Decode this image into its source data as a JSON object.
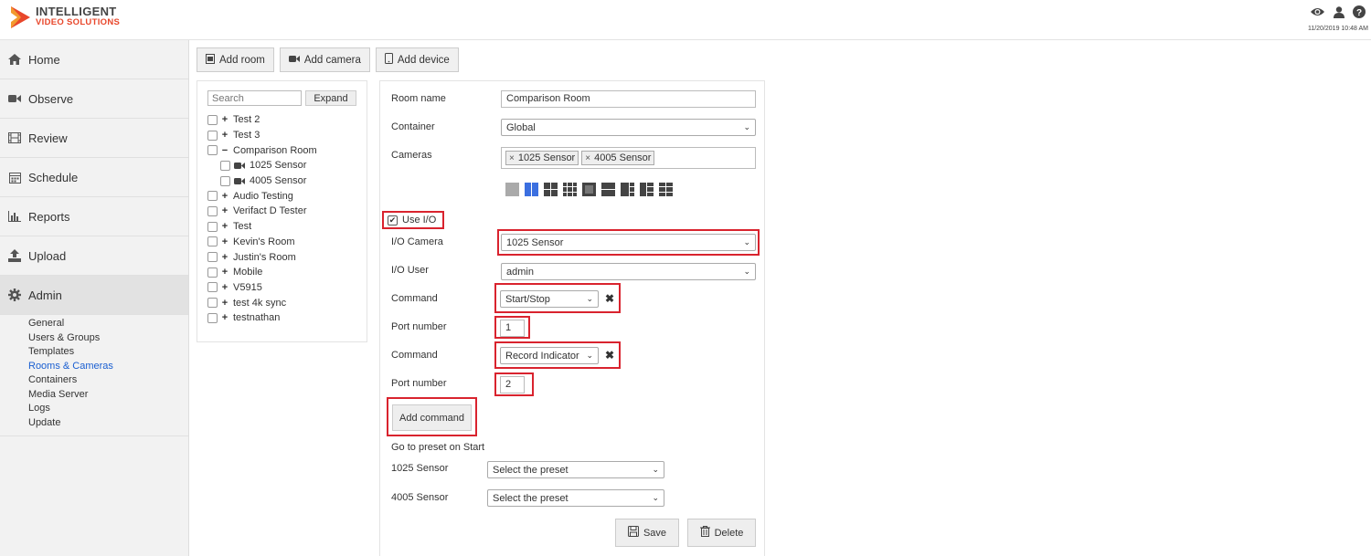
{
  "app": {
    "logo_line1": "INTELLIGENT",
    "logo_line2": "VIDEO SOLUTIONS",
    "datetime": "11/20/2019 10:48 AM",
    "brand_accent": "#e8472b",
    "header_icons": [
      "eye-icon",
      "user-icon",
      "help-icon"
    ]
  },
  "sidebar": {
    "items": [
      {
        "label": "Home",
        "icon": "home-icon"
      },
      {
        "label": "Observe",
        "icon": "video-camera-icon"
      },
      {
        "label": "Review",
        "icon": "film-icon"
      },
      {
        "label": "Schedule",
        "icon": "calendar-icon"
      },
      {
        "label": "Reports",
        "icon": "bar-chart-icon"
      },
      {
        "label": "Upload",
        "icon": "upload-icon"
      },
      {
        "label": "Admin",
        "icon": "gear-icon"
      }
    ],
    "admin_sub": [
      "General",
      "Users & Groups",
      "Templates",
      "Rooms & Cameras",
      "Containers",
      "Media Server",
      "Logs",
      "Update"
    ],
    "link_color": "#1a5fd1"
  },
  "toolbar": {
    "add_room": "Add room",
    "add_camera": "Add camera",
    "add_device": "Add device"
  },
  "tree": {
    "search_placeholder": "Search",
    "expand_label": "Expand",
    "rooms": [
      {
        "label": "Test 2",
        "toggle": "+"
      },
      {
        "label": "Test 3",
        "toggle": "+"
      },
      {
        "label": "Comparison Room",
        "toggle": "−"
      },
      {
        "label": "1025 Sensor",
        "child": true
      },
      {
        "label": "4005 Sensor",
        "child": true
      },
      {
        "label": "Audio Testing",
        "toggle": "+"
      },
      {
        "label": "Verifact D Tester",
        "toggle": "+"
      },
      {
        "label": "Test",
        "toggle": "+"
      },
      {
        "label": "Kevin's Room",
        "toggle": "+"
      },
      {
        "label": "Justin's Room",
        "toggle": "+"
      },
      {
        "label": "Mobile",
        "toggle": "+"
      },
      {
        "label": "V5915",
        "toggle": "+"
      },
      {
        "label": "test 4k sync",
        "toggle": "+"
      },
      {
        "label": "testnathan",
        "toggle": "+"
      }
    ]
  },
  "form": {
    "room_name_label": "Room name",
    "room_name_value": "Comparison Room",
    "container_label": "Container",
    "container_value": "Global",
    "cameras_label": "Cameras",
    "camera_tags": [
      "1025 Sensor",
      "4005 Sensor"
    ],
    "use_io_label": "Use I/O",
    "io_camera_label": "I/O Camera",
    "io_camera_value": "1025 Sensor",
    "io_user_label": "I/O User",
    "io_user_value": "admin",
    "command_label": "Command",
    "command1_value": "Start/Stop",
    "port_label": "Port number",
    "port1_value": "1",
    "command2_value": "Record Indicator",
    "port2_value": "2",
    "add_command_label": "Add command",
    "preset_heading": "Go to preset on Start",
    "preset_rows": [
      {
        "label": "1025 Sensor",
        "value": "Select the preset"
      },
      {
        "label": "4005 Sensor",
        "value": "Select the preset"
      }
    ],
    "save_label": "Save",
    "delete_label": "Delete",
    "highlight_color": "#d9232e"
  }
}
